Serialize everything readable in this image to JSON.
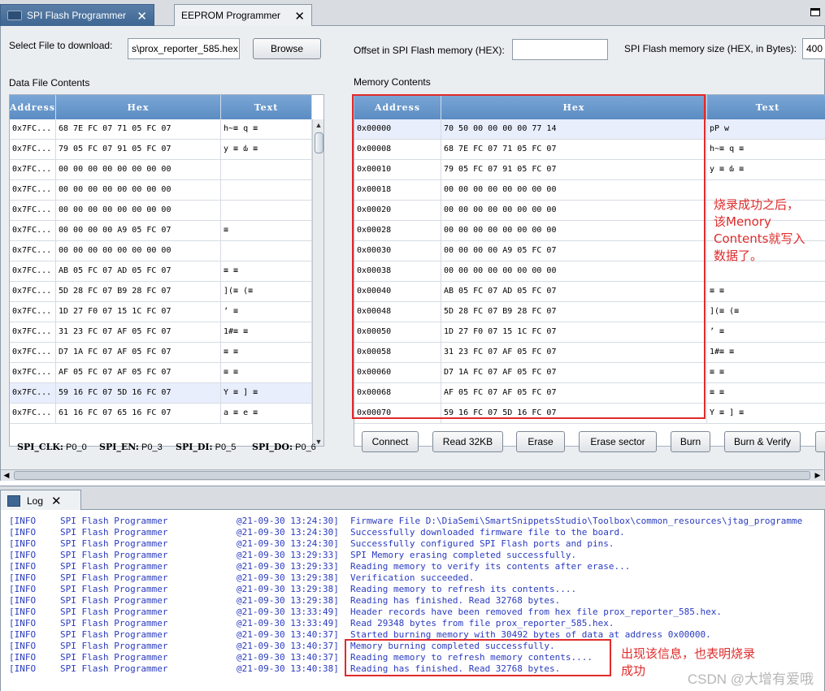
{
  "tabs": [
    {
      "label": "SPI Flash Programmer",
      "active": true
    },
    {
      "label": "EEPROM Programmer",
      "active": false
    }
  ],
  "file": {
    "label": "Select File to download:",
    "value": "s\\prox_reporter_585.hex",
    "browse_label": "Browse"
  },
  "offset": {
    "label": "Offset in SPI Flash memory (HEX):",
    "value": ""
  },
  "memsize": {
    "label": "SPI Flash memory size (HEX, in Bytes):",
    "value": "400"
  },
  "data_file": {
    "title": "Data File Contents",
    "columns": [
      "Address",
      "Hex",
      "Text"
    ],
    "rows": [
      {
        "address": "0x7FC...",
        "hex": "68 7E FC 07 71 05 FC 07",
        "text": "h~≡  q  ≡"
      },
      {
        "address": "0x7FC...",
        "hex": "79 05 FC 07 91 05 FC 07",
        "text": "y  ≡  ԃ  ≡"
      },
      {
        "address": "0x7FC...",
        "hex": "00 00 00 00 00 00 00 00",
        "text": ""
      },
      {
        "address": "0x7FC...",
        "hex": "00 00 00 00 00 00 00 00",
        "text": ""
      },
      {
        "address": "0x7FC...",
        "hex": "00 00 00 00 00 00 00 00",
        "text": ""
      },
      {
        "address": "0x7FC...",
        "hex": "00 00 00 00 A9 05 FC 07",
        "text": "      ≡"
      },
      {
        "address": "0x7FC...",
        "hex": "00 00 00 00 00 00 00 00",
        "text": ""
      },
      {
        "address": "0x7FC...",
        "hex": "AB 05 FC 07 AD 05 FC 07",
        "text": "   ≡     ≡"
      },
      {
        "address": "0x7FC...",
        "hex": "5D 28 FC 07 B9 28 FC 07",
        "text": "](≡    (≡"
      },
      {
        "address": "0x7FC...",
        "hex": "1D 27 F0 07 15 1C FC 07",
        "text": "  ʼ        ≡"
      },
      {
        "address": "0x7FC...",
        "hex": "31 23 FC 07 AF 05 FC 07",
        "text": "1#≡      ≡"
      },
      {
        "address": "0x7FC...",
        "hex": "D7 1A FC 07 AF 05 FC 07",
        "text": "   ≡     ≡"
      },
      {
        "address": "0x7FC...",
        "hex": "AF 05 FC 07 AF 05 FC 07",
        "text": "   ≡     ≡"
      },
      {
        "address": "0x7FC...",
        "hex": "59 16 FC 07 5D 16 FC 07",
        "text": "Y  ≡  ]  ≡"
      },
      {
        "address": "0x7FC...",
        "hex": "61 16 FC 07 65 16 FC 07",
        "text": "a  ≡  e  ≡"
      }
    ]
  },
  "memory": {
    "title": "Memory Contents",
    "columns": [
      "Address",
      "Hex",
      "Text"
    ],
    "rows": [
      {
        "address": "0x00000",
        "hex": "70 50 00 00 00 00 77 14",
        "text": "pP     w"
      },
      {
        "address": "0x00008",
        "hex": "68 7E FC 07 71 05 FC 07",
        "text": "h~≡  q  ≡"
      },
      {
        "address": "0x00010",
        "hex": "79 05 FC 07 91 05 FC 07",
        "text": "y  ≡  ԃ  ≡"
      },
      {
        "address": "0x00018",
        "hex": "00 00 00 00 00 00 00 00",
        "text": ""
      },
      {
        "address": "0x00020",
        "hex": "00 00 00 00 00 00 00 00",
        "text": ""
      },
      {
        "address": "0x00028",
        "hex": "00 00 00 00 00 00 00 00",
        "text": ""
      },
      {
        "address": "0x00030",
        "hex": "00 00 00 00 A9 05 FC 07",
        "text": ""
      },
      {
        "address": "0x00038",
        "hex": "00 00 00 00 00 00 00 00",
        "text": ""
      },
      {
        "address": "0x00040",
        "hex": "AB 05 FC 07 AD 05 FC 07",
        "text": "    ≡     ≡"
      },
      {
        "address": "0x00048",
        "hex": "5D 28 FC 07 B9 28 FC 07",
        "text": "](≡    (≡"
      },
      {
        "address": "0x00050",
        "hex": "1D 27 F0 07 15 1C FC 07",
        "text": "  ʼ        ≡"
      },
      {
        "address": "0x00058",
        "hex": "31 23 FC 07 AF 05 FC 07",
        "text": "1#≡      ≡"
      },
      {
        "address": "0x00060",
        "hex": "D7 1A FC 07 AF 05 FC 07",
        "text": "   ≡     ≡"
      },
      {
        "address": "0x00068",
        "hex": "AF 05 FC 07 AF 05 FC 07",
        "text": "   ≡     ≡"
      },
      {
        "address": "0x00070",
        "hex": "59 16 FC 07 5D 16 FC 07",
        "text": "Y  ≡  ]  ≡"
      }
    ]
  },
  "pins": [
    {
      "name": "SPI_CLK:",
      "value": "P0_0"
    },
    {
      "name": "SPI_EN:",
      "value": "P0_3"
    },
    {
      "name": "SPI_DI:",
      "value": "P0_5"
    },
    {
      "name": "SPI_DO:",
      "value": "P0_6"
    }
  ],
  "actions": [
    "Connect",
    "Read 32KB",
    "Erase",
    "Erase sector",
    "Burn",
    "Burn & Verify"
  ],
  "log": {
    "tab_label": "Log",
    "entries": [
      {
        "level": "[INFO",
        "source": "SPI Flash Programmer",
        "time": "@21-09-30 13:24:30]",
        "message": "Firmware File D:\\DiaSemi\\SmartSnippetsStudio\\Toolbox\\common_resources\\jtag_programme"
      },
      {
        "level": "[INFO",
        "source": "SPI Flash Programmer",
        "time": "@21-09-30 13:24:30]",
        "message": "Successfully downloaded firmware file to the board."
      },
      {
        "level": "[INFO",
        "source": "SPI Flash Programmer",
        "time": "@21-09-30 13:24:30]",
        "message": "Successfully configured SPI Flash ports and pins."
      },
      {
        "level": "[INFO",
        "source": "SPI Flash Programmer",
        "time": "@21-09-30 13:29:33]",
        "message": "SPI Memory erasing completed successfully."
      },
      {
        "level": "[INFO",
        "source": "SPI Flash Programmer",
        "time": "@21-09-30 13:29:33]",
        "message": "Reading memory to verify its contents after erase..."
      },
      {
        "level": "[INFO",
        "source": "SPI Flash Programmer",
        "time": "@21-09-30 13:29:38]",
        "message": "Verification succeeded."
      },
      {
        "level": "[INFO",
        "source": "SPI Flash Programmer",
        "time": "@21-09-30 13:29:38]",
        "message": "Reading memory to refresh its contents...."
      },
      {
        "level": "[INFO",
        "source": "SPI Flash Programmer",
        "time": "@21-09-30 13:29:38]",
        "message": "Reading has finished. Read 32768 bytes."
      },
      {
        "level": "[INFO",
        "source": "SPI Flash Programmer",
        "time": "@21-09-30 13:33:49]",
        "message": "Header records have been removed from hex file prox_reporter_585.hex."
      },
      {
        "level": "[INFO",
        "source": "SPI Flash Programmer",
        "time": "@21-09-30 13:33:49]",
        "message": "Read 29348 bytes from file prox_reporter_585.hex."
      },
      {
        "level": "[INFO",
        "source": "SPI Flash Programmer",
        "time": "@21-09-30 13:40:37]",
        "message": "Started burning memory with 30492 bytes of data at address 0x00000."
      },
      {
        "level": "[INFO",
        "source": "SPI Flash Programmer",
        "time": "@21-09-30 13:40:37]",
        "message": "Memory burning completed successfully."
      },
      {
        "level": "[INFO",
        "source": "SPI Flash Programmer",
        "time": "@21-09-30 13:40:37]",
        "message": "Reading memory to refresh memory contents...."
      },
      {
        "level": "[INFO",
        "source": "SPI Flash Programmer",
        "time": "@21-09-30 13:40:38]",
        "message": "Reading has finished. Read 32768 bytes."
      }
    ]
  },
  "annotations": {
    "memory_note": [
      "烧录成功之后，",
      "该Menory",
      "Contents就写入",
      "数据了。"
    ],
    "log_note": [
      "出现该信息，也表明烧录",
      "成功"
    ],
    "accent": "#e02b2b"
  },
  "watermark": "CSDN @大增有爱哦"
}
